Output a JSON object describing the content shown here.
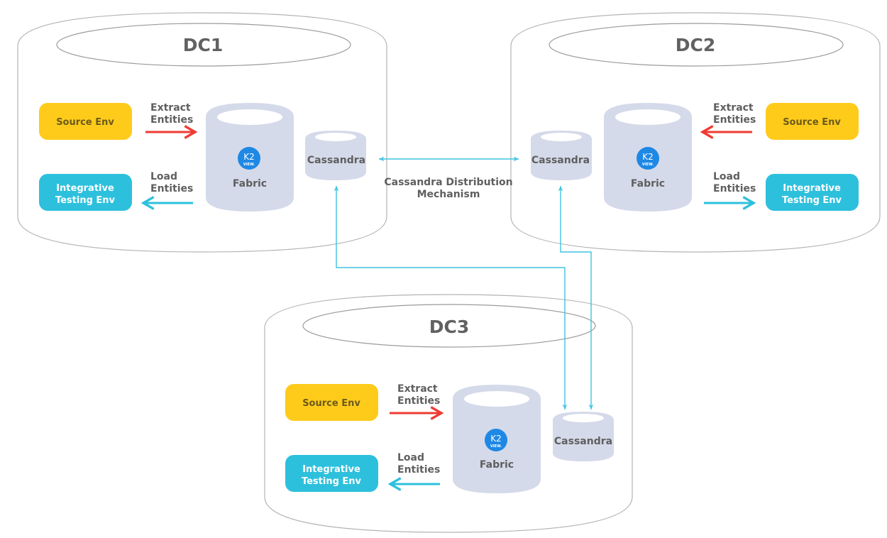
{
  "colors": {
    "source_env": "#FECB1B",
    "testing_env": "#2DC0DD",
    "extract_arrow": "#EE3B33",
    "load_arrow": "#2DC0DD",
    "cylinder": "#D5DAEA",
    "logo": "#1E88E5",
    "link": "#3FC3E0"
  },
  "logo": {
    "line1": "K2",
    "line2": "VIEW."
  },
  "datacenters": [
    {
      "title": "DC1",
      "source_env": "Source Env",
      "testing_env": [
        "Integrative",
        "Testing Env"
      ],
      "extract": [
        "Extract",
        "Entities"
      ],
      "load": [
        "Load",
        "Entities"
      ],
      "fabric": "Fabric",
      "cassandra": "Cassandra"
    },
    {
      "title": "DC2",
      "source_env": "Source Env",
      "testing_env": [
        "Integrative",
        "Testing Env"
      ],
      "extract": [
        "Extract",
        "Entities"
      ],
      "load": [
        "Load",
        "Entities"
      ],
      "fabric": "Fabric",
      "cassandra": "Cassandra"
    },
    {
      "title": "DC3",
      "source_env": "Source Env",
      "testing_env": [
        "Integrative",
        "Testing Env"
      ],
      "extract": [
        "Extract",
        "Entities"
      ],
      "load": [
        "Load",
        "Entities"
      ],
      "fabric": "Fabric",
      "cassandra": "Cassandra"
    }
  ],
  "distribution_label": [
    "Cassandra Distribution",
    "Mechanism"
  ]
}
